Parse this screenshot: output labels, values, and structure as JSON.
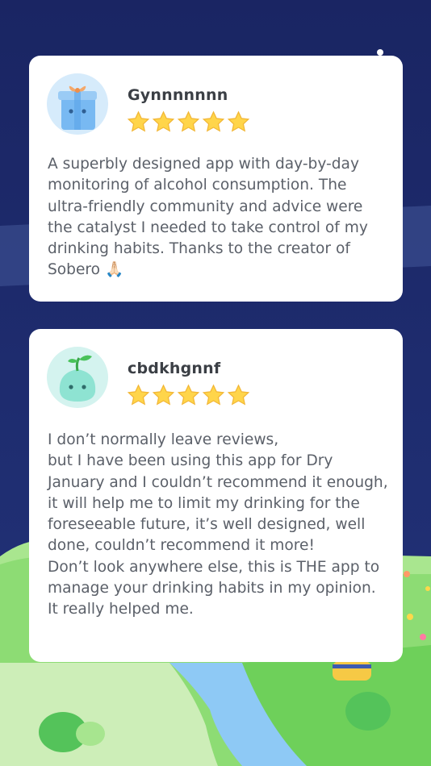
{
  "colors": {
    "background": "#1b2a6e",
    "card": "#ffffff",
    "star": "#ffd54a",
    "text": "#5b6069",
    "name": "#3b3f45",
    "grass": "#7fd86a",
    "river": "#8ec9f5"
  },
  "reviews": [
    {
      "avatar_icon": "gift-box-mascot-icon",
      "username": "Gynnnnnnn",
      "rating": 5,
      "text": "A superbly designed app with day-by-day monitoring of alcohol consumption. The ultra-friendly community and advice were the catalyst I needed to take control of my drinking habits. Thanks to the creator of Sobero 🙏🏻"
    },
    {
      "avatar_icon": "sprout-mascot-icon",
      "username": "cbdkhgnnf",
      "rating": 5,
      "text": "I don’t normally leave reviews,\nbut I have been using this app for Dry January and I couldn’t recommend it enough, it will help me to limit my drinking for the foreseeable future, it’s well designed, well done, couldn’t recommend it more!\nDon’t look anywhere else, this is THE app to manage your drinking habits in my opinion. It really helped me."
    }
  ]
}
